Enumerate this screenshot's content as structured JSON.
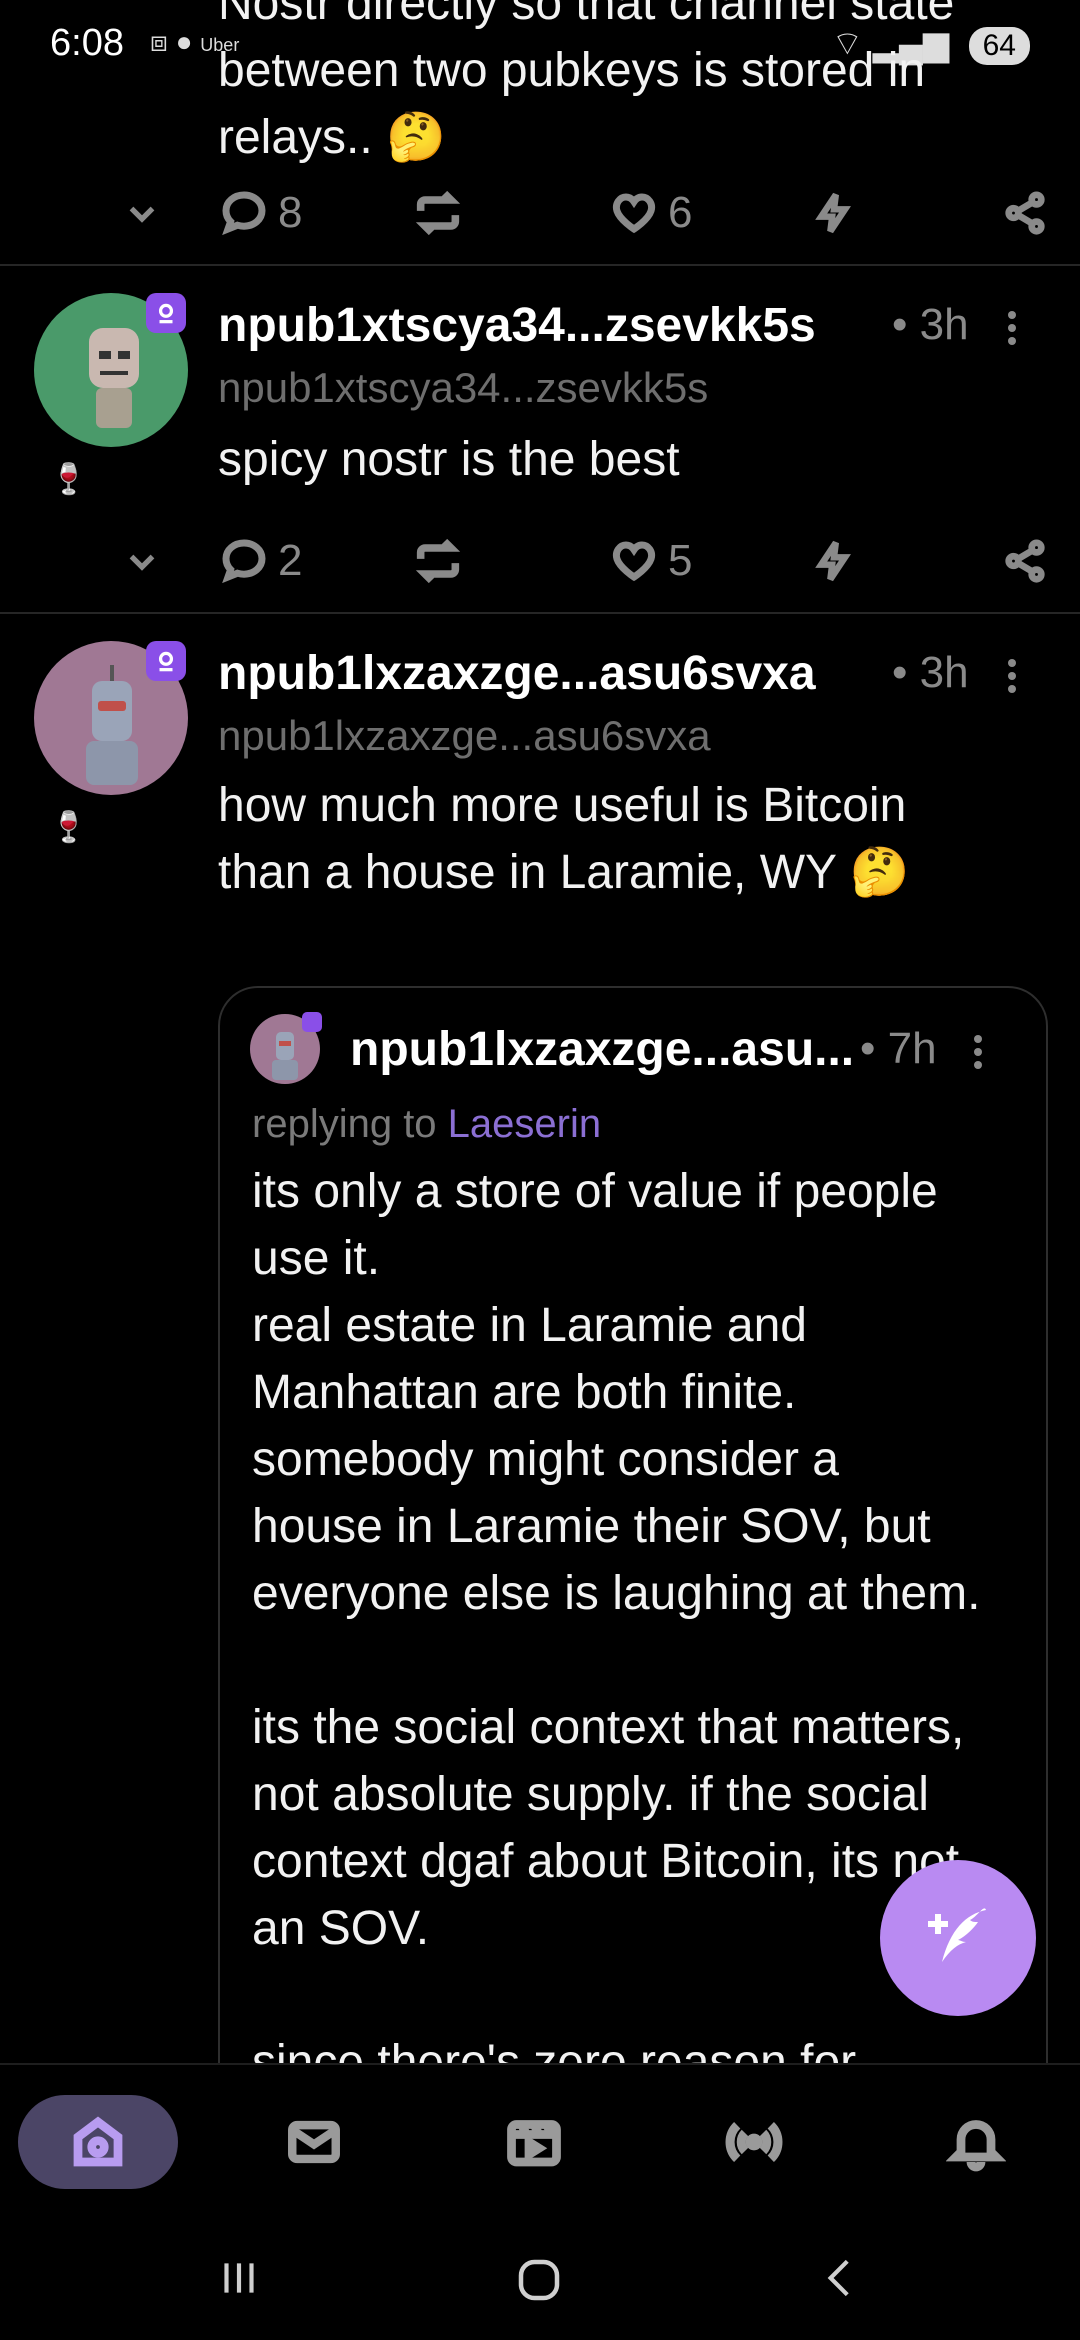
{
  "status_bar": {
    "time": "6:08",
    "battery": "64",
    "carrier_label": "Uber"
  },
  "post_partial": {
    "text_line1": "Nostr directly so that channel state",
    "text_line2": "between two pubkeys is stored in",
    "text_line3": "relays.. 🤔",
    "replies": "8",
    "likes": "6"
  },
  "post2": {
    "name": "npub1xtscya34...zsevkk5s",
    "handle": "npub1xtscya34...zsevkk5s",
    "time": "• 3h",
    "text": "spicy nostr is the best",
    "replies": "2",
    "likes": "5"
  },
  "post3": {
    "name": "npub1lxzaxzge...asu6svxa",
    "handle": "npub1lxzaxzge...asu6svxa",
    "time": "• 3h",
    "text_line1": "how much more useful is Bitcoin",
    "text_line2": "than a house in Laramie, WY 🤔",
    "quoted": {
      "name": "npub1lxzaxzge...asu...",
      "time": "• 7h",
      "replying_prefix": "replying to ",
      "replying_to": "Laeserin",
      "lines": [
        "its only a store of value if people",
        "use it.",
        "real estate in Laramie and",
        "Manhattan are both finite.",
        "somebody might consider a",
        "house in Laramie their SOV, but",
        "everyone else is laughing at them.",
        "",
        "its the social context that matters,",
        "not absolute supply. if the social",
        "context dgaf about Bitcoin, its not",
        "an SOV.",
        "",
        "since there's zero reason for"
      ]
    }
  },
  "nav": {
    "items": [
      "home-icon",
      "messages-icon",
      "video-icon",
      "live-icon",
      "notifications-icon"
    ],
    "active": "home-icon"
  },
  "colors": {
    "accent": "#b98af2",
    "badge": "#8a4fe8",
    "link": "#8b6fd3",
    "active_tab_bg": "#4b4566"
  }
}
